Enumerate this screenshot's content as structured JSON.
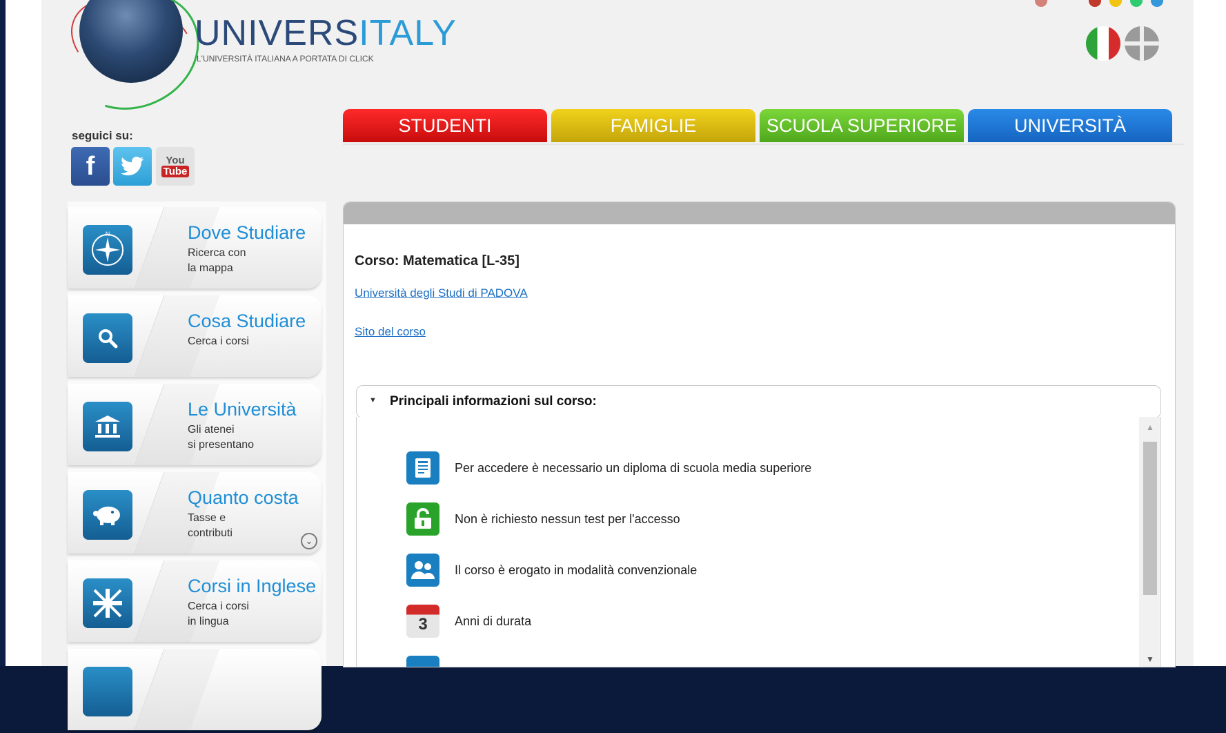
{
  "header": {
    "logo_title_main": "UNIVERS",
    "logo_title_accent": "ITALY",
    "logo_subtitle": "L'UNIVERSITÀ ITALIANA A PORTATA DI CLICK",
    "languages": [
      "italian-flag",
      "english-flag"
    ]
  },
  "social": {
    "label": "seguici su:",
    "facebook": "f",
    "youtube_top": "You",
    "youtube_bottom": "Tube"
  },
  "tabs": [
    {
      "label": "STUDENTI",
      "color": "#e01515"
    },
    {
      "label": "FAMIGLIE",
      "color": "#d9bb10"
    },
    {
      "label": "SCUOLA SUPERIORE",
      "color": "#62bf28"
    },
    {
      "label": "UNIVERSITÀ",
      "color": "#1f78d6"
    }
  ],
  "menu": [
    {
      "title": "Dove Studiare",
      "desc1": "Ricerca con",
      "desc2": "la mappa",
      "icon": "compass-icon"
    },
    {
      "title": "Cosa Studiare",
      "desc1": "Cerca i corsi",
      "desc2": "",
      "icon": "search-icon"
    },
    {
      "title": "Le Università",
      "desc1": "Gli atenei",
      "desc2": "si presentano",
      "icon": "university-icon"
    },
    {
      "title": "Quanto costa",
      "desc1": "Tasse e contributi",
      "desc2": "",
      "icon": "piggy-bank-icon"
    },
    {
      "title": "Corsi in Inglese",
      "desc1": "Cerca i corsi",
      "desc2": "in lingua",
      "icon": "union-jack-icon"
    }
  ],
  "main": {
    "course_title": "Corso: Matematica [L-35]",
    "university_link": "Università degli Studi di PADOVA",
    "site_link": "Sito del corso",
    "accordion_title": "Principali informazioni sul corso:",
    "info": [
      {
        "text": "Per accedere è necessario un diploma di scuola media superiore",
        "icon": "diploma-icon",
        "color": "#1a7fc0"
      },
      {
        "text": "Non è richiesto nessun test per l'accesso",
        "icon": "unlock-icon",
        "color": "#2aa32a"
      },
      {
        "text": "Il corso è erogato in modalità convenzionale",
        "icon": "people-icon",
        "color": "#1a7fc0"
      },
      {
        "text": "Anni di durata",
        "icon": "calendar-icon",
        "color": "#d32a2a",
        "badge": "3"
      }
    ]
  }
}
